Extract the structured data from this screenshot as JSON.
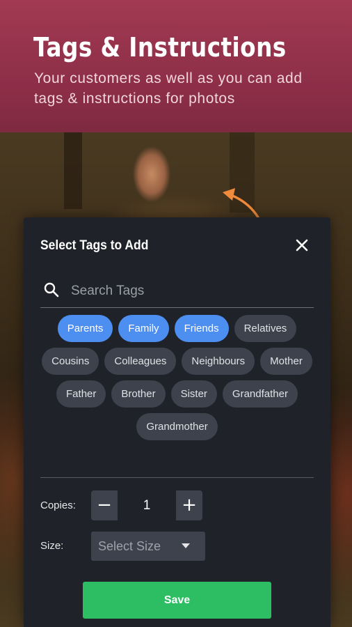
{
  "banner": {
    "title": "Tags & Instructions",
    "subtitle": "Your customers as well as you can add tags & instructions for photos"
  },
  "dialog": {
    "title": "Select Tags to Add",
    "close_icon": "close-icon",
    "search": {
      "icon": "search-icon",
      "placeholder": "Search Tags",
      "value": ""
    },
    "tags": [
      {
        "label": "Parents",
        "selected": true
      },
      {
        "label": "Family",
        "selected": true
      },
      {
        "label": "Friends",
        "selected": true
      },
      {
        "label": "Relatives",
        "selected": false
      },
      {
        "label": "Cousins",
        "selected": false
      },
      {
        "label": "Colleagues",
        "selected": false
      },
      {
        "label": "Neighbours",
        "selected": false
      },
      {
        "label": "Mother",
        "selected": false
      },
      {
        "label": "Father",
        "selected": false
      },
      {
        "label": "Brother",
        "selected": false
      },
      {
        "label": "Sister",
        "selected": false
      },
      {
        "label": "Grandfather",
        "selected": false
      },
      {
        "label": "Grandmother",
        "selected": false
      }
    ],
    "copies": {
      "label": "Copies:",
      "minus": "−",
      "value": "1",
      "plus": "+"
    },
    "size": {
      "label": "Size:",
      "placeholder": "Select Size"
    },
    "save_label": "Save"
  },
  "colors": {
    "banner": "#9a3550",
    "dialog_bg": "#1f2229",
    "tag_bg": "#3d424c",
    "tag_selected": "#4d8ff0",
    "save": "#2dbd62",
    "arrow": "#f08a3c"
  }
}
